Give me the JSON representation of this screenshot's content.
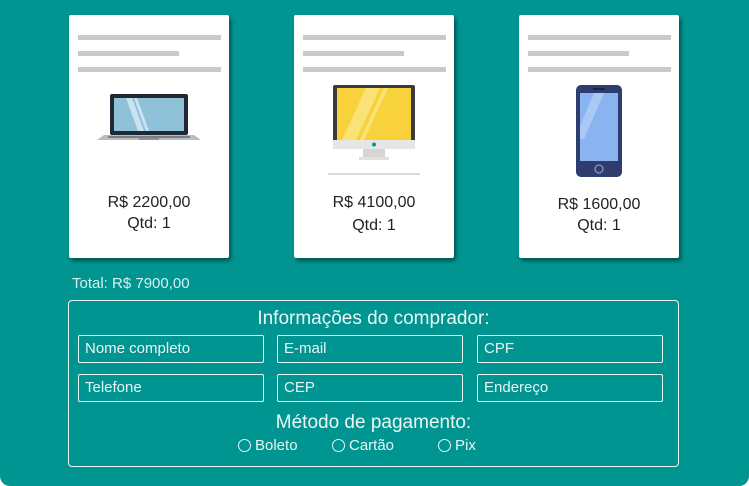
{
  "products": [
    {
      "price": "R$ 2200,00",
      "qty": "Qtd: 1",
      "image_icon": "laptop-icon"
    },
    {
      "price": "R$ 4100,00",
      "qty": "Qtd: 1",
      "image_icon": "monitor-icon"
    },
    {
      "price": "R$ 1600,00",
      "qty": "Qtd: 1",
      "image_icon": "smartphone-icon"
    }
  ],
  "total": "Total: R$ 7900,00",
  "buyer_form": {
    "title": "Informações do comprador:",
    "fields": [
      {
        "placeholder": "Nome completo"
      },
      {
        "placeholder": "E-mail"
      },
      {
        "placeholder": "CPF"
      },
      {
        "placeholder": "Telefone"
      },
      {
        "placeholder": "CEP"
      },
      {
        "placeholder": "Endereço"
      }
    ]
  },
  "payment": {
    "title": "Método de pagamento:",
    "options": [
      "Boleto",
      "Cartão",
      "Pix"
    ]
  },
  "colors": {
    "background": "#009591",
    "card": "#ffffff",
    "placeholder_line": "#c9c9c9"
  }
}
